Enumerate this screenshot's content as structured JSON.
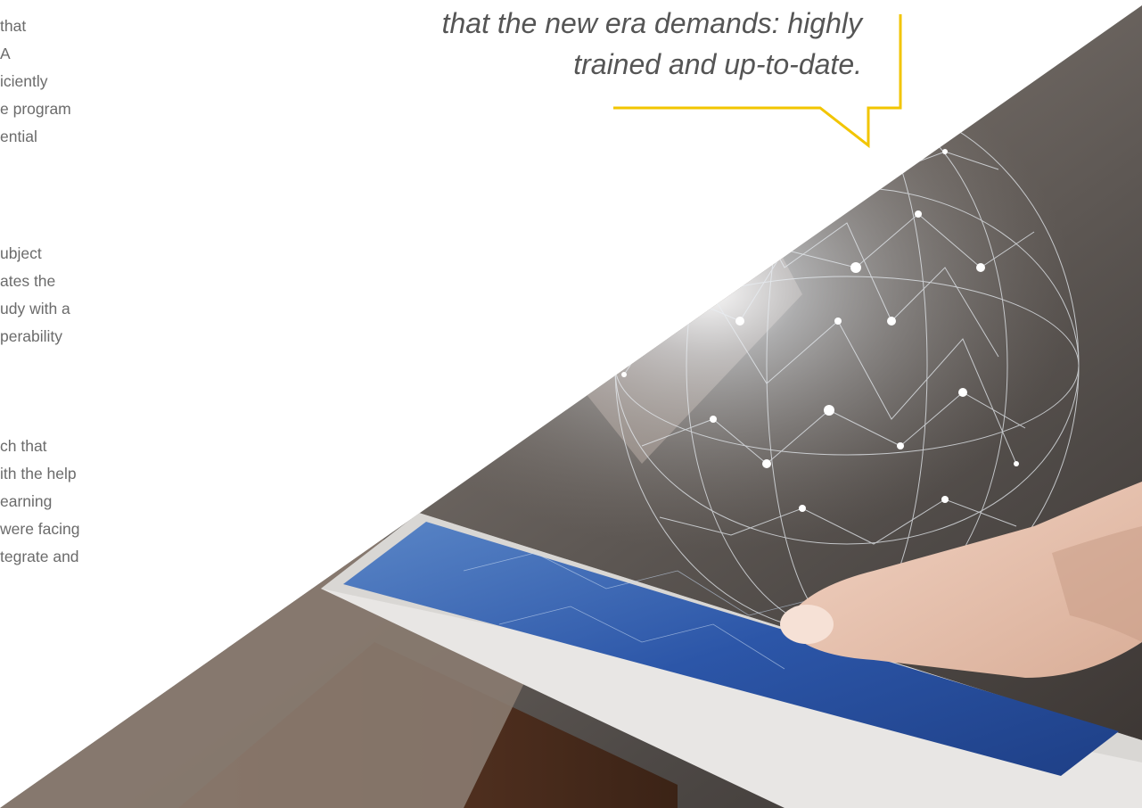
{
  "left_text": {
    "paragraph_1": [
      "that",
      "A",
      "iciently",
      "e program",
      "ential"
    ],
    "paragraph_2": [
      "ubject",
      "ates the",
      "udy with a",
      "perability"
    ],
    "paragraph_3": [
      "ch that",
      "ith the help",
      "earning",
      "were facing",
      "tegrate and"
    ]
  },
  "quote": {
    "line_1": "that the new era demands: highly",
    "line_2": "trained and up-to-date."
  },
  "colors": {
    "accent": "#F2C500",
    "text_body": "#6b6b6b",
    "text_quote": "#555555"
  },
  "image": {
    "subject": "hand-touching-tablet-with-network-globe"
  }
}
